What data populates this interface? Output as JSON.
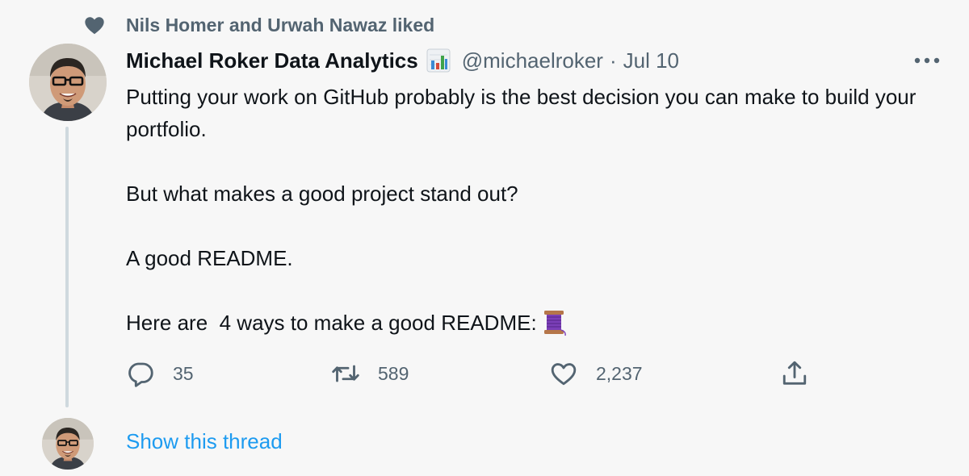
{
  "social_context": {
    "icon": "heart-icon",
    "text": "Nils Homer and Urwah Nawaz liked"
  },
  "author": {
    "display_name": "Michael Roker Data Analytics",
    "name_emoji": "bar-chart-emoji",
    "handle": "@michaelroker",
    "separator": "·",
    "date": "Jul 10"
  },
  "body": {
    "paragraphs": [
      "Putting your work on GitHub probably is the best decision you can make to build your portfolio.",
      "But what makes a good project stand out?",
      "A good README.",
      "Here are  4 ways to make a good README:"
    ],
    "trailing_emoji": "thread-spool-emoji"
  },
  "actions": {
    "reply_count": "35",
    "retweet_count": "589",
    "like_count": "2,237"
  },
  "footer": {
    "show_thread": "Show this thread"
  },
  "colors": {
    "background": "#f7f7f7",
    "text": "#0f1419",
    "secondary": "#536471",
    "link": "#1d9bf0",
    "thread_line": "#cfd9de"
  }
}
